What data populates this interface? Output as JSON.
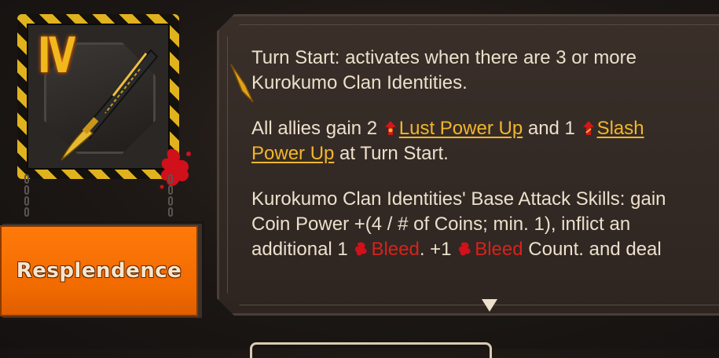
{
  "ego_gift": {
    "tier": "IV",
    "name": "Resplendence",
    "colors": {
      "accent": "#f0b81c",
      "name_button": "#ff7a0a",
      "keyword_yellow": "#f2b62c",
      "keyword_red": "#d8221a",
      "text": "#ece0cc"
    }
  },
  "description": {
    "p1": "Turn Start: activates when there are 3 or more",
    "p1b": "Kurokumo Clan Identities.",
    "p2_a": "All allies gain 2",
    "p2_kw1": "Lust Power Up",
    "p2_b": "and 1",
    "p2_kw2a": "Slash",
    "p2_kw2b": "Power Up",
    "p2_c": "at Turn Start.",
    "p3_a": "Kurokumo Clan Identities' Base Attack Skills: gain",
    "p3_b": "Coin Power +(4 / # of Coins; min. 1), inflict an",
    "p3_c": "additional 1",
    "p3_kw1": "Bleed",
    "p3_d": ". +1",
    "p3_kw2": "Bleed",
    "p3_e": "Count. and deal"
  },
  "icons": [
    "roman-numeral-badge",
    "katana-icon",
    "blood-splatter-icon",
    "pen-nib-icon",
    "lust-power-up-icon",
    "slash-power-up-icon",
    "bleed-icon",
    "scroll-down-arrow-icon"
  ]
}
